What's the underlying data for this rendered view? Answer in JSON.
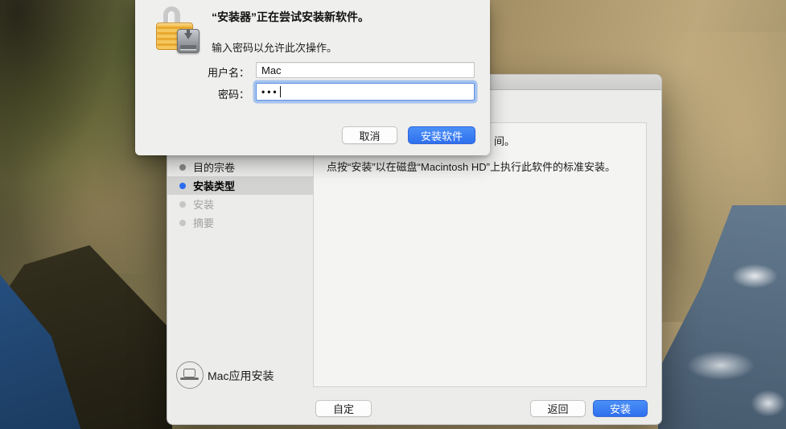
{
  "colors": {
    "accent_blue": "#3577f1",
    "step_current_bullet": "#2a6df0",
    "sidebar_highlight": "#d3d3d2",
    "window_background": "#ececeb",
    "dialog_background": "#efefed",
    "water_navy": "#1d3d61",
    "water_slate": "#55697d"
  },
  "auth_dialog": {
    "icon": "lock-with-installer-badge",
    "title": "“安装器”正在尝试安装新软件。",
    "subtitle": "输入密码以允许此次操作。",
    "username_label": "用户名：",
    "username_value": "Mac",
    "password_label": "密码：",
    "password_masked_value": "•••",
    "buttons": {
      "cancel": "取消",
      "confirm": "安装软件"
    }
  },
  "installer_window": {
    "sidebar_steps": [
      {
        "label": "目的宗卷",
        "state": "completed"
      },
      {
        "label": "安装类型",
        "state": "current"
      },
      {
        "label": "安装",
        "state": "pending"
      },
      {
        "label": "摘要",
        "state": "pending"
      }
    ],
    "content_pane": {
      "truncated_line_fragment": "间。",
      "instruction_line": "点按“安装”以在磁盘“Macintosh HD”上执行此软件的标准安装。"
    },
    "footer": {
      "source_icon": "laptop-in-circle",
      "source_label": "Mac应用安装",
      "buttons": {
        "customize": "自定",
        "back": "返回",
        "install": "安装"
      }
    }
  }
}
